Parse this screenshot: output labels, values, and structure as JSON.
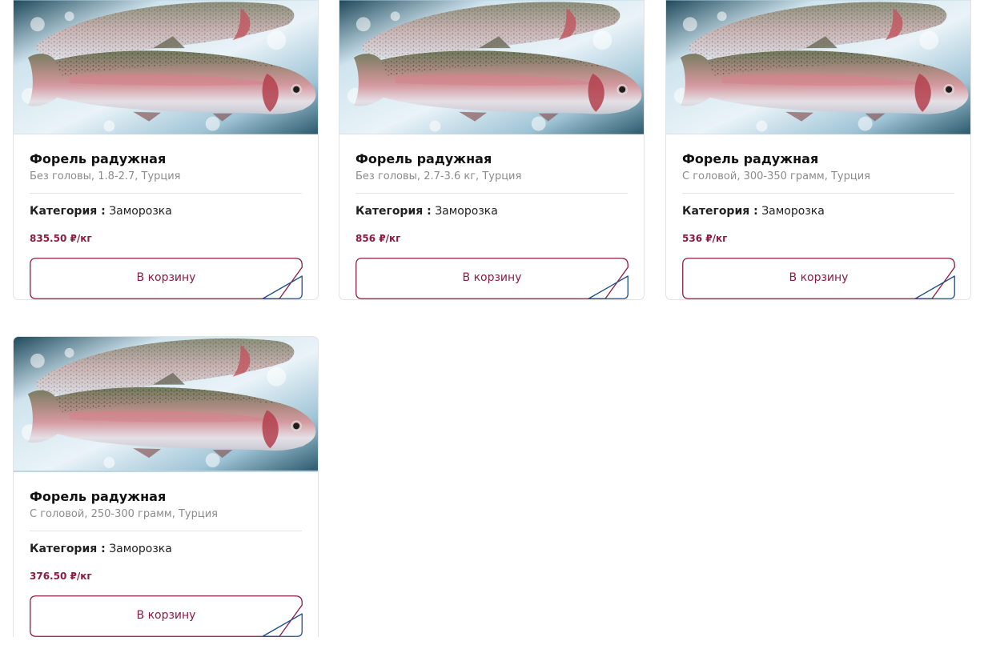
{
  "colors": {
    "accent": "#8c1b3f",
    "accent_secondary": "#1f4e8c",
    "muted_text": "#8b8b8b"
  },
  "products": [
    {
      "image_icon": "rainbow-trout-photo",
      "title": "Форель радужная",
      "subtitle": "Без головы, 1.8-2.7, Турция",
      "category_label": "Категория :",
      "category_value": "Заморозка",
      "price": "835.50 ₽/кг",
      "button_label": "В корзину"
    },
    {
      "image_icon": "rainbow-trout-photo",
      "title": "Форель радужная",
      "subtitle": "Без головы, 2.7-3.6 кг, Турция",
      "category_label": "Категория :",
      "category_value": "Заморозка",
      "price": "856 ₽/кг",
      "button_label": "В корзину"
    },
    {
      "image_icon": "rainbow-trout-photo",
      "title": "Форель радужная",
      "subtitle": "С головой, 300-350 грамм, Турция",
      "category_label": "Категория :",
      "category_value": "Заморозка",
      "price": "536 ₽/кг",
      "button_label": "В корзину"
    },
    {
      "image_icon": "rainbow-trout-photo",
      "title": "Форель радужная",
      "subtitle": "С головой, 250-300 грамм, Турция",
      "category_label": "Категория :",
      "category_value": "Заморозка",
      "price": "376.50 ₽/кг",
      "button_label": "В корзину"
    }
  ]
}
